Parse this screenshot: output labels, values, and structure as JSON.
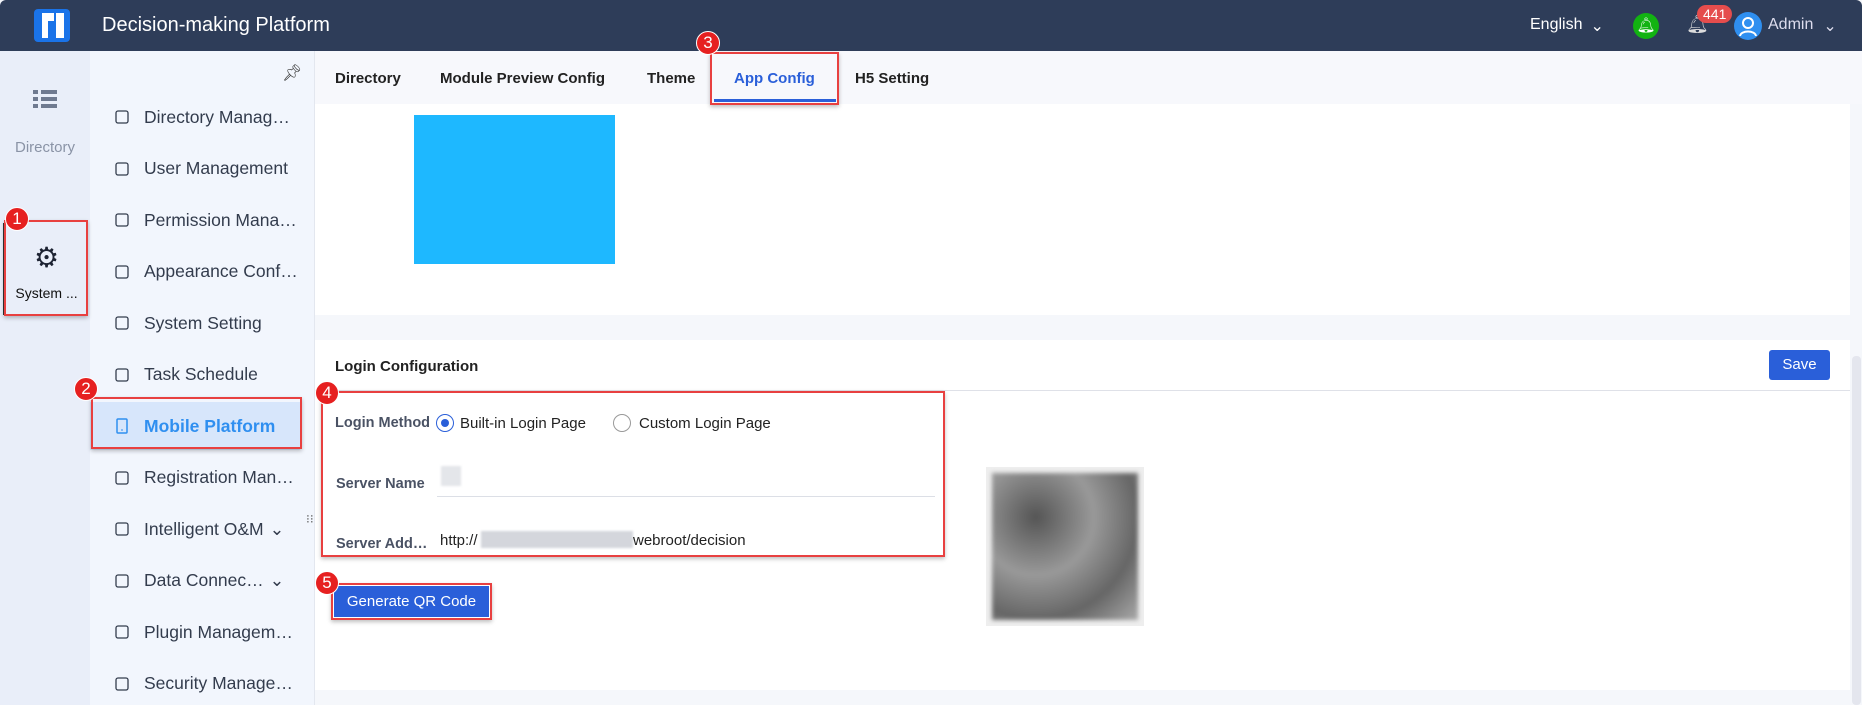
{
  "header": {
    "title": "Decision-making Platform",
    "language": "English",
    "notification_count": "441",
    "user": "Admin"
  },
  "rail": {
    "items": [
      {
        "label": "Directory"
      },
      {
        "label": "System ..."
      }
    ]
  },
  "menu": {
    "items": [
      {
        "label": "Directory Manag…"
      },
      {
        "label": "User Management"
      },
      {
        "label": "Permission Mana…"
      },
      {
        "label": "Appearance Conf…"
      },
      {
        "label": "System Setting"
      },
      {
        "label": "Task Schedule"
      },
      {
        "label": "Mobile Platform"
      },
      {
        "label": "Registration Man…"
      },
      {
        "label": "Intelligent O&M"
      },
      {
        "label": "Data Connec…"
      },
      {
        "label": "Plugin Managem…"
      },
      {
        "label": "Security Manage…"
      }
    ]
  },
  "tabs": [
    {
      "label": "Directory"
    },
    {
      "label": "Module Preview Config"
    },
    {
      "label": "Theme"
    },
    {
      "label": "App Config"
    },
    {
      "label": "H5 Setting"
    }
  ],
  "login_config": {
    "title": "Login Configuration",
    "save": "Save",
    "login_method_label": "Login Method",
    "option_builtin": "Built-in Login Page",
    "option_custom": "Custom Login Page",
    "selected": "Built-in Login Page",
    "server_name_label": "Server Name",
    "server_address_label": "Server Add…",
    "server_address_prefix": "http://",
    "server_address_suffix": "webroot/decision",
    "generate_button": "Generate QR Code"
  },
  "steps": [
    "1",
    "2",
    "3",
    "4",
    "5"
  ],
  "colors": {
    "header": "#2e3d59",
    "accent": "#2a5fd9",
    "annotation": "#e84040",
    "placeholder_image": "#1eb8ff"
  }
}
